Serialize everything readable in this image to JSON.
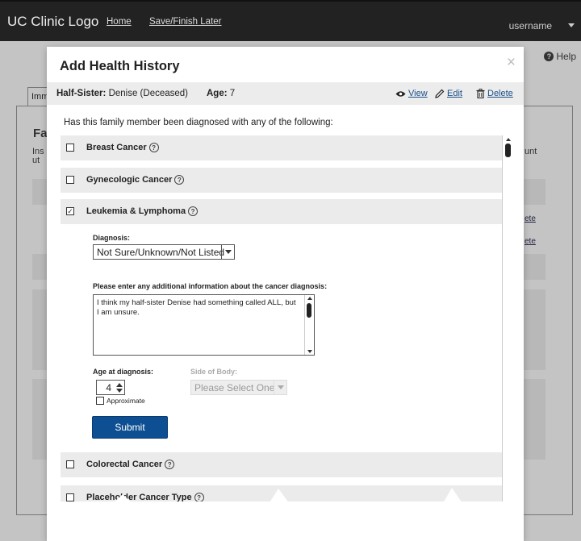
{
  "header": {
    "logo": "UC Clinic Logo",
    "nav": [
      "Home",
      "Save/Finish Later"
    ],
    "username": "username"
  },
  "background": {
    "help": "Help",
    "tab_fragment": "Imm",
    "heading_fragment": "Fa",
    "line1_fragment": "Ins",
    "line2_fragment": "ut",
    "right_fragment": "unt",
    "link_fragments": [
      "ete",
      "ete"
    ]
  },
  "modal": {
    "title": "Add Health History",
    "close": "×",
    "member": {
      "relation_label": "Half-Sister:",
      "name": "Denise (Deceased)",
      "age_label": "Age:",
      "age": "7"
    },
    "actions": {
      "view": "View",
      "edit": "Edit",
      "delete": "Delete"
    },
    "question": "Has this family member been diagnosed with any of the following:",
    "categories": [
      {
        "label": "Breast Cancer",
        "checked": false
      },
      {
        "label": "Gynecologic Cancer",
        "checked": false
      },
      {
        "label": "Leukemia & Lymphoma",
        "checked": true
      },
      {
        "label": "Colorectal Cancer",
        "checked": false
      },
      {
        "label": "Placeholder Cancer Type",
        "checked": false
      }
    ],
    "form": {
      "diagnosis_label": "Diagnosis:",
      "diagnosis_value": "Not Sure/Unknown/Not Listed",
      "info_label": "Please enter any additional information about the cancer diagnosis:",
      "info_value": "I think my half-sister Denise had something called ALL, but I am unsure.",
      "age_label": "Age at diagnosis:",
      "age_value": "4",
      "approx_label": "Approximate",
      "side_label": "Side of Body:",
      "side_placeholder": "Please Select One",
      "submit": "Submit"
    }
  }
}
